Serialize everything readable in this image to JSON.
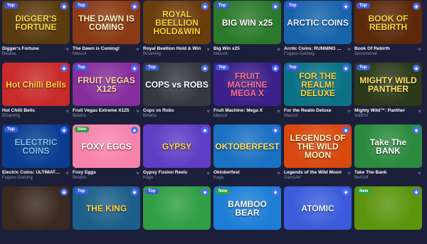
{
  "games": [
    {
      "title": "Digger's Fortune",
      "provider": "Belatra",
      "badge": "Top",
      "art": "DIGGER'S FORTUNE",
      "bg": "#5a3b10",
      "fg": "#ffd43b"
    },
    {
      "title": "The Dawn is Coming!",
      "provider": "Mascot",
      "badge": "Top",
      "art": "THE DAWN IS COMING",
      "bg": "#8a3b14",
      "fg": "#fff3bf"
    },
    {
      "title": "Royal Beellion Hold & Win",
      "provider": "BGaming",
      "badge": "",
      "art": "ROYAL BEELLION HOLD&WIN",
      "bg": "#6b3d0d",
      "fg": "#ffd43b"
    },
    {
      "title": "Big Win x25",
      "provider": "Mascot",
      "badge": "Top",
      "art": "BIG WIN x25",
      "bg": "#2b7a2b",
      "fg": "#fff"
    },
    {
      "title": "Arctic Coins: RUNNING WINS™",
      "provider": "Fugaso Gaming",
      "badge": "Top",
      "art": "ARCTIC COINS",
      "bg": "#1864ab",
      "fg": "#e7f5ff"
    },
    {
      "title": "Book Of Rebirth",
      "provider": "Spinomenal",
      "badge": "Top",
      "art": "BOOK OF REBIRTH",
      "bg": "#5c2a0a",
      "fg": "#ffd43b"
    },
    {
      "title": "Hot Chilli Bells",
      "provider": "BGaming",
      "badge": "",
      "art": "Hot Chilli Bells",
      "bg": "#c92a2a",
      "fg": "#ffd43b"
    },
    {
      "title": "Fruit Vegas Extreme X125",
      "provider": "Belatra",
      "badge": "Top",
      "art": "FRUIT VEGAS X125",
      "bg": "#862e9c",
      "fg": "#ffd8a8"
    },
    {
      "title": "Cops vs Robs",
      "provider": "Belatra",
      "badge": "Top",
      "art": "COPS vs ROBS",
      "bg": "#343a40",
      "fg": "#ffffff"
    },
    {
      "title": "Fruit Machine: Mega X",
      "provider": "Mascot",
      "badge": "Top",
      "art": "FRUIT MACHINE MEGA X",
      "bg": "#3b1f8a",
      "fg": "#ff6b9a"
    },
    {
      "title": "For the Realm Deluxe",
      "provider": "Mascot",
      "badge": "Top",
      "art": "FOR THE REALM! DELUXE",
      "bg": "#0b7285",
      "fg": "#ffd43b"
    },
    {
      "title": "Mighty Wild™: Panther",
      "provider": "VoltEnt",
      "badge": "Top",
      "art": "MIGHTY WILD PANTHER",
      "bg": "#2b3a1a",
      "fg": "#ffe066"
    },
    {
      "title": "Electric Coins: ULTIMATE RU...",
      "provider": "Fugaso Gaming",
      "badge": "Top",
      "art": "ELECTRIC COINS",
      "bg": "#0b3d91",
      "fg": "#74c0fc"
    },
    {
      "title": "Foxy Eggs",
      "provider": "Belatra",
      "badge": "New",
      "art": "FOXY EGGS",
      "bg": "#f783ac",
      "fg": "#ffffff"
    },
    {
      "title": "Gypsy Fusion Reels",
      "provider": "Kaga",
      "badge": "",
      "art": "GYPSY",
      "bg": "#5f3dc4",
      "fg": "#ffd43b"
    },
    {
      "title": "Oktoberfest",
      "provider": "Kaga",
      "badge": "",
      "art": "OKTOBERFEST",
      "bg": "#1971c2",
      "fg": "#ffe066"
    },
    {
      "title": "Legends of the Wild Moon",
      "provider": "GamzArt",
      "badge": "",
      "art": "LEGENDS OF THE WILD MOON",
      "bg": "#d9480f",
      "fg": "#fff3bf"
    },
    {
      "title": "Take The Bank",
      "provider": "BetSoft",
      "badge": "",
      "art": "Take The BANK",
      "bg": "#2b8a3e",
      "fg": "#ffffff"
    },
    {
      "title": "",
      "provider": "",
      "badge": "",
      "art": "",
      "bg": "#3a2a20",
      "fg": "#fff"
    },
    {
      "title": "",
      "provider": "",
      "badge": "Top",
      "art": "THE KING",
      "bg": "#1c5f8a",
      "fg": "#ffd43b"
    },
    {
      "title": "",
      "provider": "",
      "badge": "Top",
      "art": "",
      "bg": "#2f9e44",
      "fg": "#fff"
    },
    {
      "title": "",
      "provider": "",
      "badge": "New",
      "art": "BAMBOO BEAR",
      "bg": "#1c7ed6",
      "fg": "#fff"
    },
    {
      "title": "",
      "provider": "",
      "badge": "",
      "art": "ATOMIC",
      "bg": "#3b5bdb",
      "fg": "#e7f5ff"
    },
    {
      "title": "",
      "provider": "",
      "badge": "New",
      "art": "",
      "bg": "#5c940d",
      "fg": "#fff"
    }
  ],
  "icons": {
    "favorite": "heart-icon",
    "gem": "gem-icon"
  }
}
